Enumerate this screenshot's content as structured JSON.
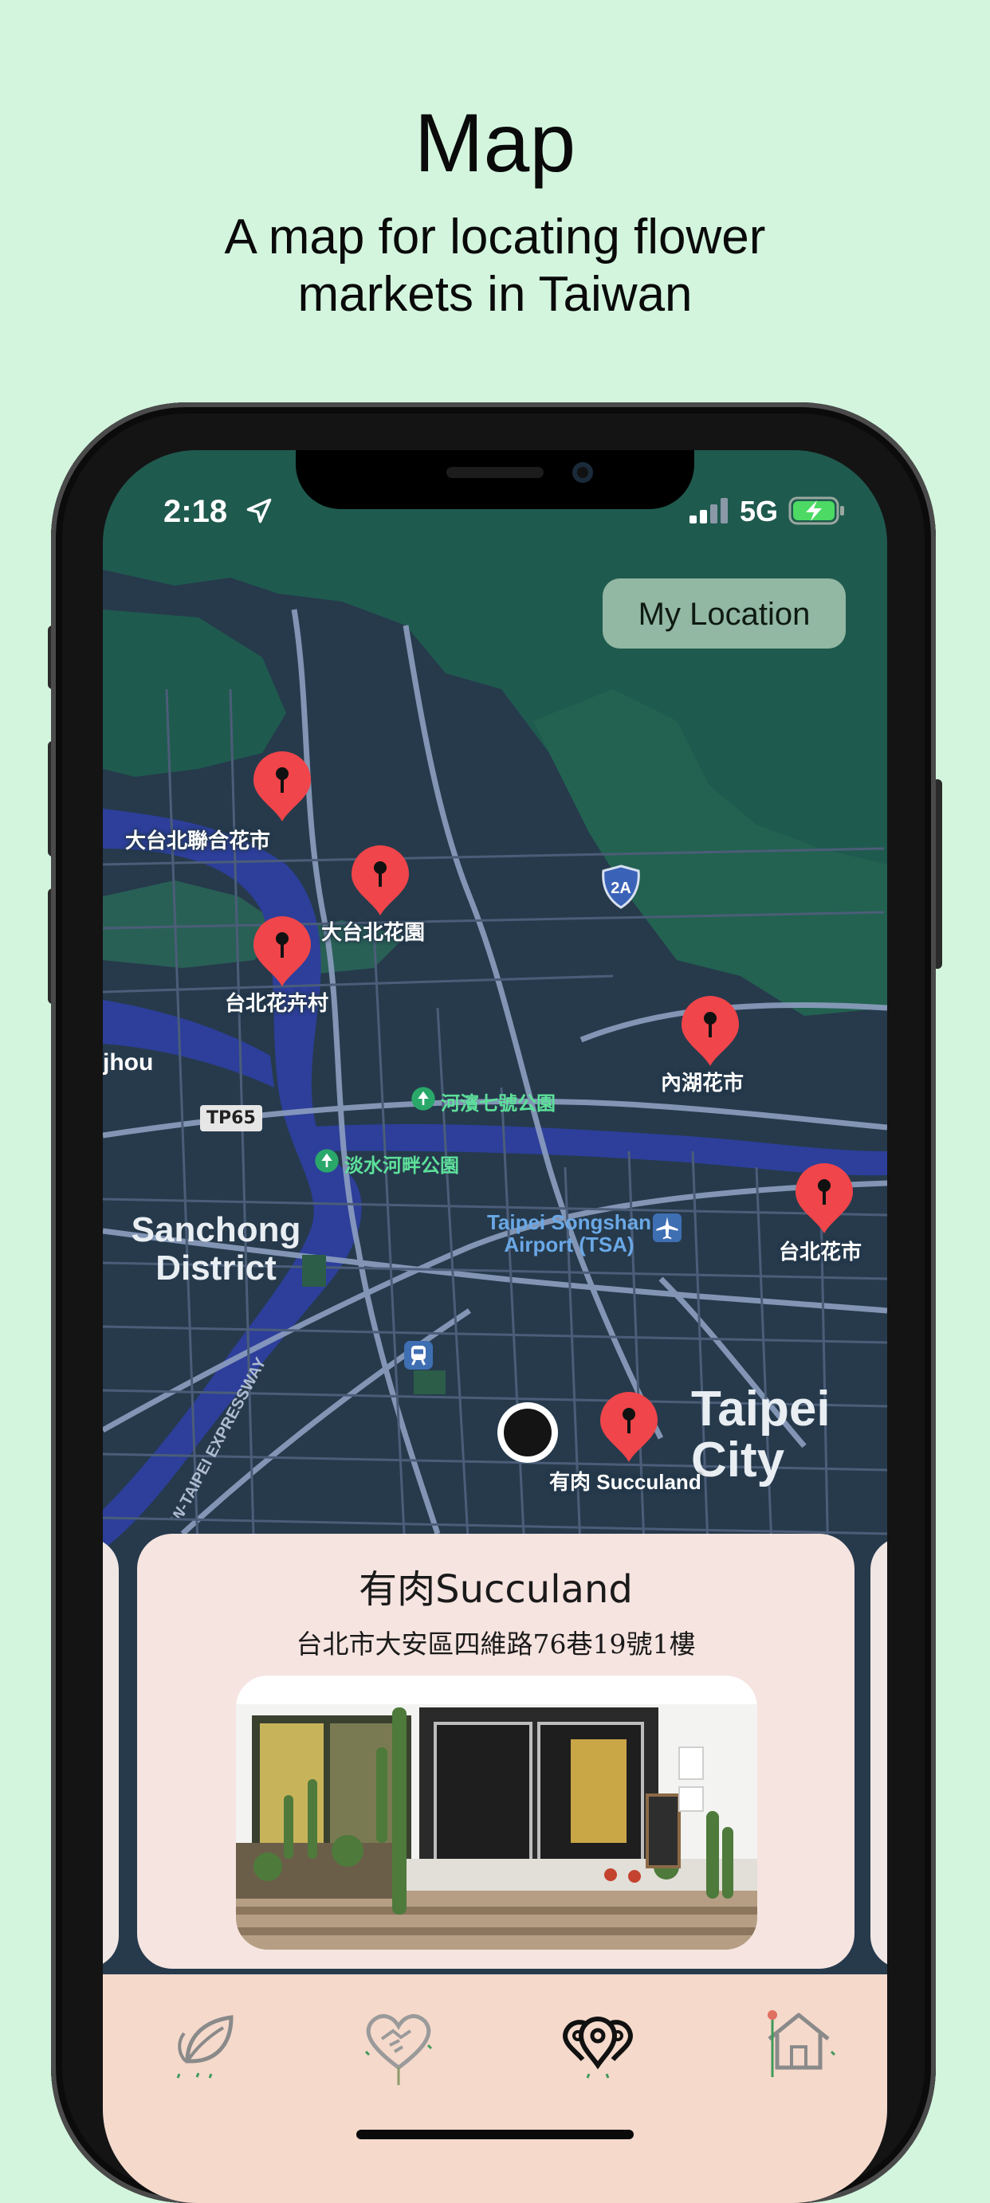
{
  "header": {
    "title": "Map",
    "subtitle": "A map for locating flower markets in Taiwan"
  },
  "status_bar": {
    "time": "2:18",
    "network": "5G"
  },
  "map": {
    "my_location_label": "My Location",
    "pins": [
      {
        "label": "大台北聯合花市"
      },
      {
        "label": "大台北花園"
      },
      {
        "label": "台北花卉村"
      },
      {
        "label": "內湖花市"
      },
      {
        "label": "台北花市"
      },
      {
        "label": "有肉 Succuland"
      }
    ],
    "parks": [
      "河濱七號公園",
      "淡水河畔公園"
    ],
    "district_label": "Sanchong District",
    "city_label": "Taipei City",
    "airport_label": "Taipei Songshan Airport (TSA)",
    "route_shield": "2A",
    "road_badge": "TP65",
    "expressway_label": "EW-TAIPEI EXPRESSWAY",
    "edge_text": "jhou"
  },
  "card": {
    "title": "有肉Succuland",
    "address": "台北市大安區四維路76巷19號1樓"
  },
  "tabs": [
    {
      "icon": "leaf-icon"
    },
    {
      "icon": "heart-handshake-icon"
    },
    {
      "icon": "map-pins-icon",
      "active": true
    },
    {
      "icon": "home-icon"
    }
  ],
  "colors": {
    "background": "#d3f5de",
    "pin": "#f0454a",
    "map_land": "#263a4c",
    "map_green": "#1f5a4e",
    "river": "#2d3f9a",
    "tabbar": "#f5d9cb"
  }
}
